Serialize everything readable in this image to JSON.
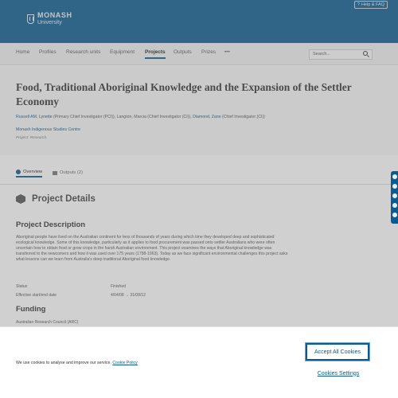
{
  "brand": {
    "line1": "MONASH",
    "line2": "University"
  },
  "help": {
    "label": "Help & FAQ"
  },
  "nav": {
    "items": [
      {
        "label": "Home"
      },
      {
        "label": "Profiles"
      },
      {
        "label": "Research units"
      },
      {
        "label": "Equipment"
      },
      {
        "label": "Projects"
      },
      {
        "label": "Outputs"
      },
      {
        "label": "Prizes"
      }
    ],
    "more": "•••",
    "active": "Projects"
  },
  "search": {
    "placeholder": "Search..."
  },
  "project": {
    "title": "Food, Traditional Aboriginal Knowledge and the Expansion of the Settler Economy",
    "investigators": {
      "p1": "Russell AM, Lynette",
      "p1_role": " (Primary Chief Investigator (PCI)), ",
      "p2": "Langton, Marcia (Chief Investigator (CI)), ",
      "p3": "Diamond, Zane",
      "p3_role": " (Chief Investigator (CI))"
    },
    "org": "Monash Indigenous Studies Centre",
    "type": "Project: Research"
  },
  "tabs": {
    "overview": "Overview",
    "outputs": "Outputs (2)"
  },
  "details": {
    "heading": "Project Details",
    "desc_heading": "Project Description",
    "description": "Aboriginal people have lived on the Australian continent for tens of thousands of years during which time they developed deep and sophisticated ecological knowledge. Some of this knowledge, particularly as it applies to food procurement was passed onto settler Australians who were often uncertain how to obtain food or grow crops in the harsh Australian environment. This project examines the ways that Aboriginal knowledge was transferred to the newcomers and how it was used over 175 years (1788-1963). Today as we face significant environmental challenges this project asks what lessons can we learn from Australia's deep traditional Aboriginal food knowledge.",
    "status_label": "Status",
    "status_value": "Finished",
    "dates_label": "Effective start/end date",
    "dates_value": "4/04/08 → 31/08/12",
    "funding_heading": "Funding",
    "funding_item": "Australian Research Council (ARC)"
  },
  "cookie": {
    "text": "We use cookies to analyse and improve our service.",
    "link": "Cookie Policy",
    "accept": "Accept All Cookies",
    "settings": "Cookies Settings"
  },
  "colors": {
    "brand_blue": "#0a5b8f"
  }
}
